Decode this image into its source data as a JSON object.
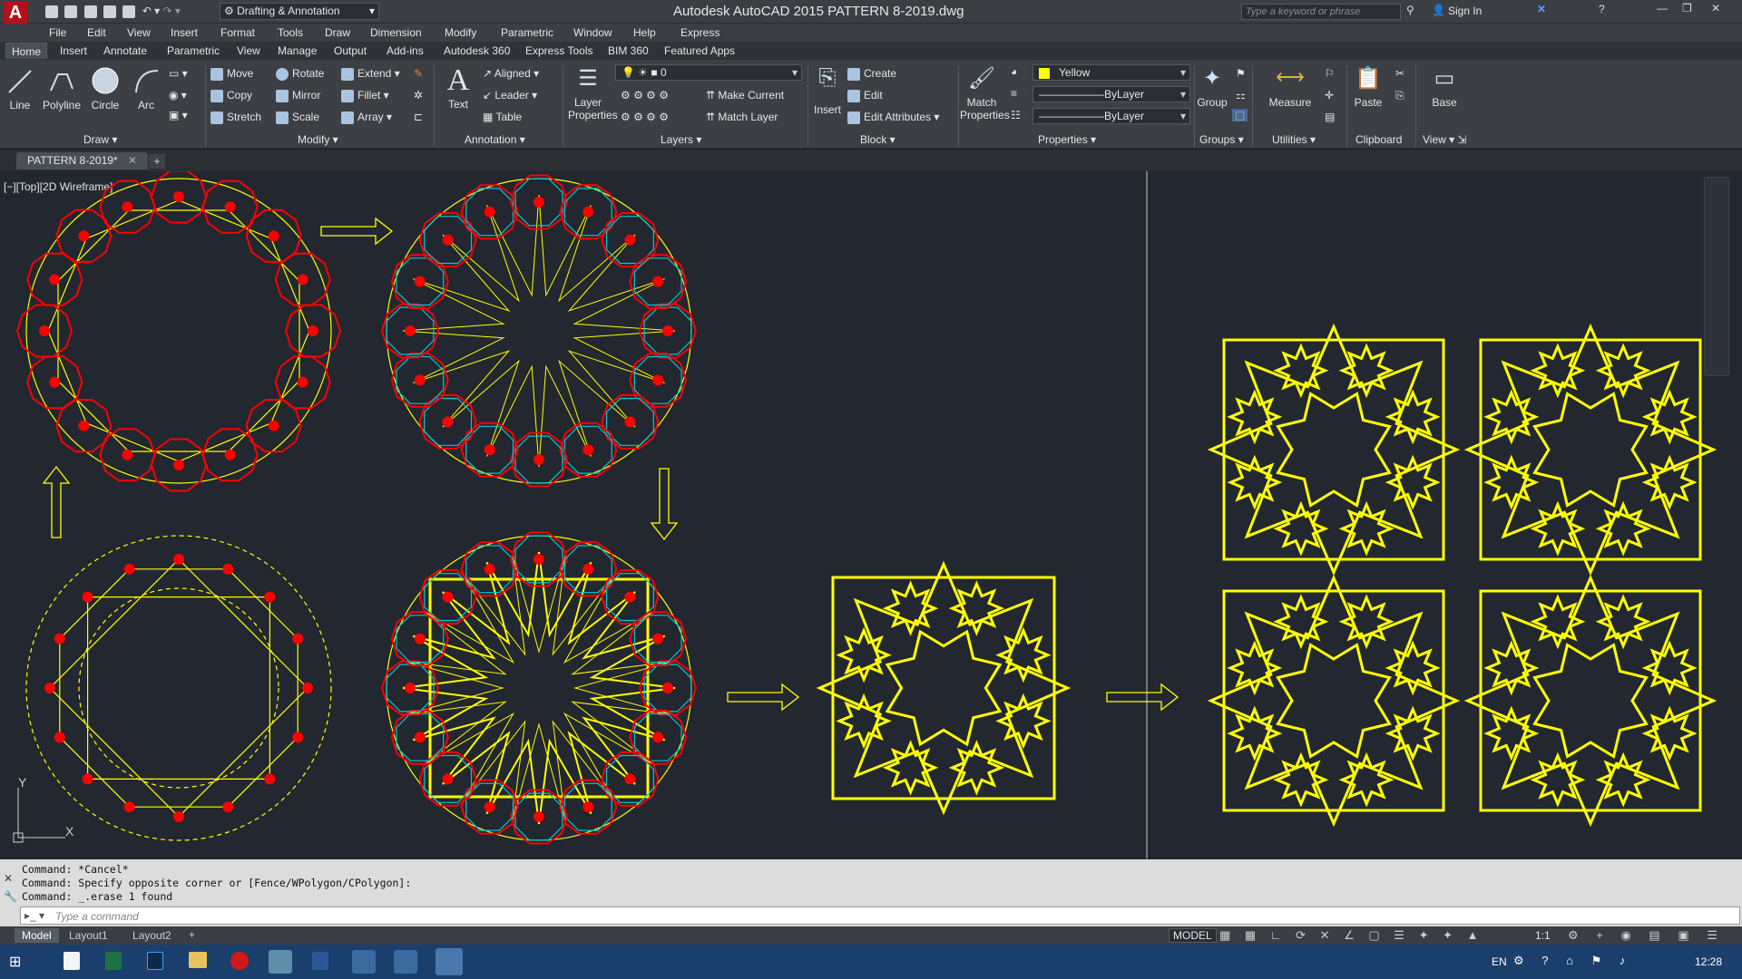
{
  "title_bar": {
    "app_title": "Autodesk AutoCAD 2015    PATTERN 8-2019.dwg",
    "workspace": "Drafting & Annotation",
    "search_placeholder": "Type a keyword or phrase",
    "sign_in": "Sign In"
  },
  "menu": [
    "File",
    "Edit",
    "View",
    "Insert",
    "Format",
    "Tools",
    "Draw",
    "Dimension",
    "Modify",
    "Parametric",
    "Window",
    "Help",
    "Express"
  ],
  "ribbon_tabs": [
    "Home",
    "Insert",
    "Annotate",
    "Parametric",
    "View",
    "Manage",
    "Output",
    "Add-ins",
    "Autodesk 360",
    "Express Tools",
    "BIM 360",
    "Featured Apps"
  ],
  "ribbon": {
    "draw": {
      "line": "Line",
      "polyline": "Polyline",
      "circle": "Circle",
      "arc": "Arc",
      "label": "Draw"
    },
    "modify": {
      "move": "Move",
      "rotate": "Rotate",
      "extend": "Extend",
      "copy": "Copy",
      "mirror": "Mirror",
      "fillet": "Fillet",
      "stretch": "Stretch",
      "scale": "Scale",
      "array": "Array",
      "label": "Modify"
    },
    "annotation": {
      "text": "Text",
      "aligned": "Aligned",
      "leader": "Leader",
      "table": "Table",
      "label": "Annotation"
    },
    "layers": {
      "layer_properties_1": "Layer",
      "layer_properties_2": "Properties",
      "current_layer": "0",
      "make_current": "Make Current",
      "match_layer": "Match Layer",
      "label": "Layers"
    },
    "block": {
      "insert": "Insert",
      "create": "Create",
      "edit": "Edit",
      "edit_attributes": "Edit Attributes",
      "label": "Block"
    },
    "properties": {
      "match_1": "Match",
      "match_2": "Properties",
      "color": "Yellow",
      "linetype": "ByLayer",
      "lineweight": "ByLayer",
      "label": "Properties"
    },
    "groups": {
      "group": "Group",
      "label": "Groups"
    },
    "utilities": {
      "measure": "Measure",
      "label": "Utilities"
    },
    "clipboard": {
      "paste": "Paste",
      "label": "Clipboard"
    },
    "view": {
      "base": "Base",
      "label": "View"
    }
  },
  "doc_tab": "PATTERN 8-2019*",
  "viewport_label": "[−][Top][2D Wireframe]",
  "ucs": {
    "x": "X",
    "y": "Y"
  },
  "colors": {
    "yellow": "#ffff00",
    "red": "#ff0000",
    "cyan": "#00c8d8",
    "bg": "#222730"
  },
  "command_history": [
    "Command: *Cancel*",
    "Command: Specify opposite corner or [Fence/WPolygon/CPolygon]:",
    "Command: _.erase 1 found"
  ],
  "command_placeholder": "Type a command",
  "layout_tabs": [
    "Model",
    "Layout1",
    "Layout2"
  ],
  "status": {
    "model": "MODEL",
    "scale": "1:1"
  },
  "taskbar": {
    "lang": "EN",
    "time": "12:28"
  }
}
